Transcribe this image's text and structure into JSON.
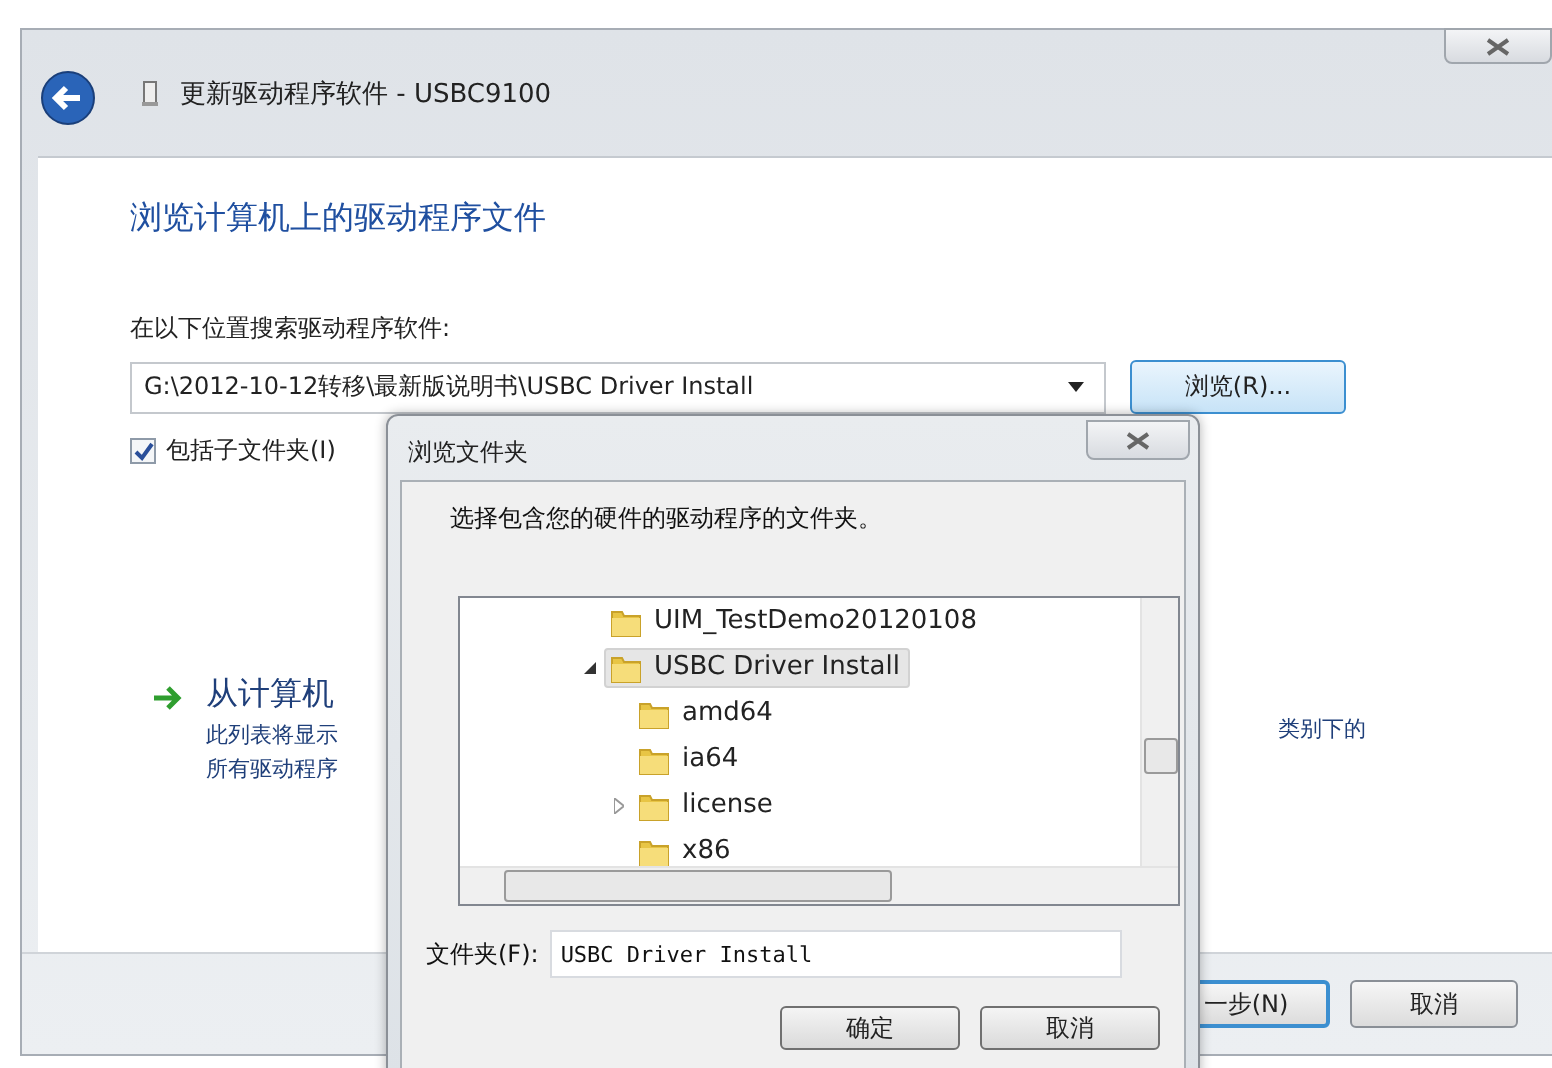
{
  "window": {
    "title": "更新驱动程序软件 - USBC9100"
  },
  "page": {
    "heading": "浏览计算机上的驱动程序文件",
    "search_label": "在以下位置搜索驱动程序软件:",
    "path": "G:\\2012-10-12转移\\最新版说明书\\USBC Driver Install",
    "browse_button": "浏览(R)...",
    "include_subfolders": {
      "label": "包括子文件夹(I)",
      "checked": true
    },
    "option": {
      "title": "从计算机",
      "lines": [
        "此列表将显示",
        "所有驱动程序"
      ],
      "tail": "类别下的"
    }
  },
  "footer": {
    "buttons": [
      {
        "label": "一步(N)",
        "default": true
      },
      {
        "label": "取消",
        "default": false
      }
    ]
  },
  "dialog": {
    "title": "浏览文件夹",
    "instruction": "选择包含您的硬件的驱动程序的文件夹。",
    "tree": [
      {
        "label": "UIM_TestDemo20120108",
        "kind": "leaf",
        "selected": false
      },
      {
        "label": "USBC Driver Install",
        "kind": "expanded",
        "selected": true,
        "children": [
          {
            "label": "amd64",
            "kind": "leaf",
            "selected": false
          },
          {
            "label": "ia64",
            "kind": "leaf",
            "selected": false
          },
          {
            "label": "license",
            "kind": "collapsed",
            "selected": false
          },
          {
            "label": "x86",
            "kind": "leaf",
            "selected": false
          }
        ]
      }
    ],
    "folder_label": "文件夹(F):",
    "folder_value": "USBC Driver Install",
    "buttons": [
      "确定",
      "取消"
    ]
  }
}
